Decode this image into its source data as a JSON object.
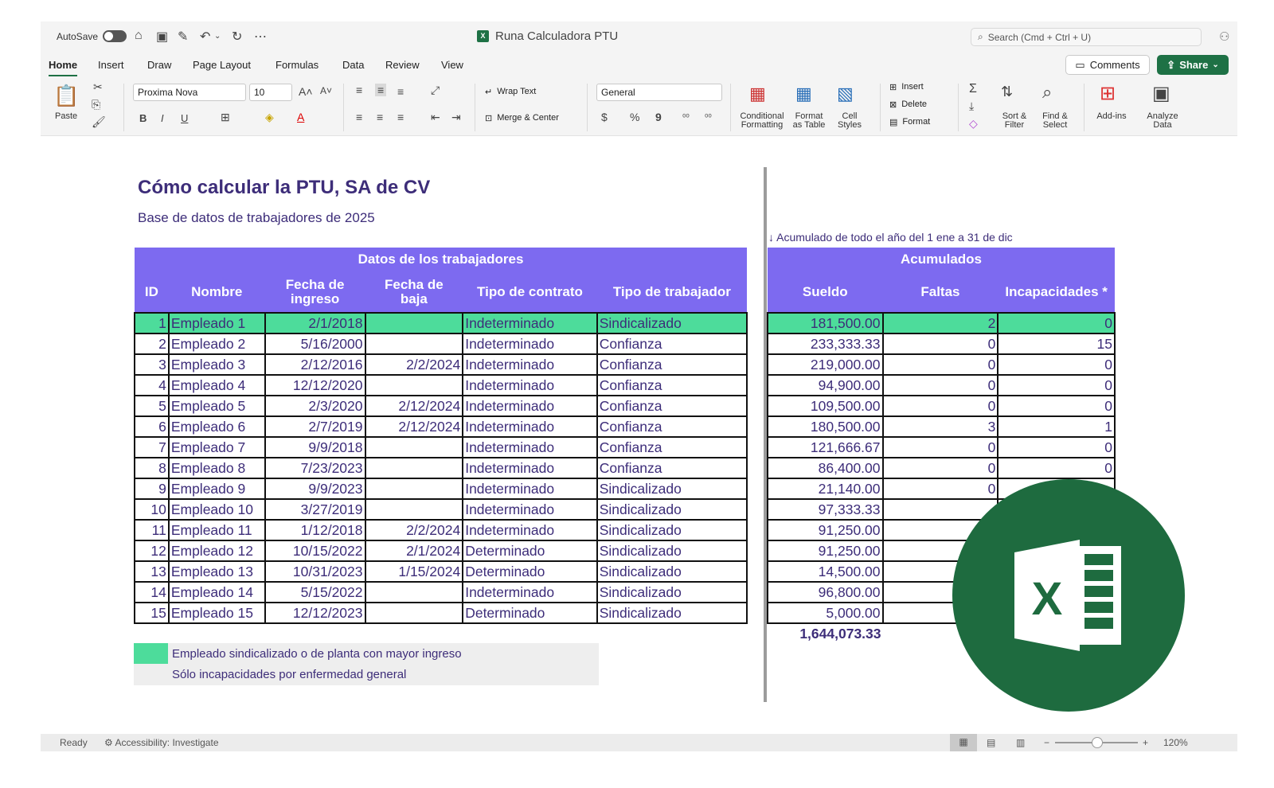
{
  "titlebar": {
    "autosave": "AutoSave",
    "doc_title": "Runa Calculadora PTU",
    "search_placeholder": "Search (Cmd + Ctrl + U)",
    "file_badge": "X"
  },
  "tabs": [
    "Home",
    "Insert",
    "Draw",
    "Page Layout",
    "Formulas",
    "Data",
    "Review",
    "View"
  ],
  "actions": {
    "comments": "Comments",
    "share": "Share"
  },
  "ribbon": {
    "paste": "Paste",
    "font": "Proxima Nova",
    "size": "10",
    "bold": "B",
    "italic": "I",
    "underline": "U",
    "wrap": "Wrap Text",
    "merge": "Merge & Center",
    "number_format": "General",
    "currency": "$",
    "percent": "%",
    "comma": "9",
    "cond1": "Conditional",
    "cond2": "Formatting",
    "fmt1": "Format",
    "fmt2": "as Table",
    "cs1": "Cell",
    "cs2": "Styles",
    "insert": "Insert",
    "delete": "Delete",
    "format": "Format",
    "sort1": "Sort &",
    "sort2": "Filter",
    "find1": "Find &",
    "find2": "Select",
    "addins": "Add-ins",
    "an1": "Analyze",
    "an2": "Data"
  },
  "sheet": {
    "title": "Cómo calcular la PTU, SA de CV",
    "subtitle": "Base de datos de trabajadores de 2025",
    "note": "↓ Acumulado de todo el año del 1 ene a 31 de dic",
    "left_group": "Datos de los trabajadores",
    "right_group": "Acumulados",
    "left_headers": [
      "ID",
      "Nombre",
      "Fecha de ingreso",
      "Fecha de baja",
      "Tipo de contrato",
      "Tipo de trabajador"
    ],
    "right_headers": [
      "Sueldo",
      "Faltas",
      "Incapacidades *"
    ],
    "rows": [
      [
        "1",
        "Empleado 1",
        "2/1/2018",
        "",
        "Indeterminado",
        "Sindicalizado"
      ],
      [
        "2",
        "Empleado 2",
        "5/16/2000",
        "",
        "Indeterminado",
        "Confianza"
      ],
      [
        "3",
        "Empleado 3",
        "2/12/2016",
        "2/2/2024",
        "Indeterminado",
        "Confianza"
      ],
      [
        "4",
        "Empleado 4",
        "12/12/2020",
        "",
        "Indeterminado",
        "Confianza"
      ],
      [
        "5",
        "Empleado 5",
        "2/3/2020",
        "2/12/2024",
        "Indeterminado",
        "Confianza"
      ],
      [
        "6",
        "Empleado 6",
        "2/7/2019",
        "2/12/2024",
        "Indeterminado",
        "Confianza"
      ],
      [
        "7",
        "Empleado 7",
        "9/9/2018",
        "",
        "Indeterminado",
        "Confianza"
      ],
      [
        "8",
        "Empleado 8",
        "7/23/2023",
        "",
        "Indeterminado",
        "Confianza"
      ],
      [
        "9",
        "Empleado 9",
        "9/9/2023",
        "",
        "Indeterminado",
        "Sindicalizado"
      ],
      [
        "10",
        "Empleado 10",
        "3/27/2019",
        "",
        "Indeterminado",
        "Sindicalizado"
      ],
      [
        "11",
        "Empleado 11",
        "1/12/2018",
        "2/2/2024",
        "Indeterminado",
        "Sindicalizado"
      ],
      [
        "12",
        "Empleado 12",
        "10/15/2022",
        "2/1/2024",
        "Determinado",
        "Sindicalizado"
      ],
      [
        "13",
        "Empleado 13",
        "10/31/2023",
        "1/15/2024",
        "Determinado",
        "Sindicalizado"
      ],
      [
        "14",
        "Empleado 14",
        "5/15/2022",
        "",
        "Indeterminado",
        "Sindicalizado"
      ],
      [
        "15",
        "Empleado 15",
        "12/12/2023",
        "",
        "Determinado",
        "Sindicalizado"
      ]
    ],
    "acc_rows": [
      [
        "181,500.00",
        "2",
        "0"
      ],
      [
        "233,333.33",
        "0",
        "15"
      ],
      [
        "219,000.00",
        "0",
        "0"
      ],
      [
        "94,900.00",
        "0",
        "0"
      ],
      [
        "109,500.00",
        "0",
        "0"
      ],
      [
        "180,500.00",
        "3",
        "1"
      ],
      [
        "121,666.67",
        "0",
        "0"
      ],
      [
        "86,400.00",
        "0",
        "0"
      ],
      [
        "21,140.00",
        "0",
        ""
      ],
      [
        "97,333.33",
        "",
        ""
      ],
      [
        "91,250.00",
        "",
        ""
      ],
      [
        "91,250.00",
        "",
        ""
      ],
      [
        "14,500.00",
        "",
        ""
      ],
      [
        "96,800.00",
        "",
        ""
      ],
      [
        "5,000.00",
        "",
        ""
      ]
    ],
    "total": "1,644,073.33",
    "legend": [
      "Empleado sindicalizado o de planta con mayor ingreso",
      "Sólo incapacidades por enfermedad general"
    ]
  },
  "logo_letter": "X",
  "status": {
    "ready": "Ready",
    "accessibility": "Accessibility: Investigate",
    "zoom": "120%"
  },
  "colors": {
    "header": "#7d6af0",
    "highlight": "#4ddc9b",
    "text": "#3d2d79",
    "excel_green": "#1e7145"
  }
}
